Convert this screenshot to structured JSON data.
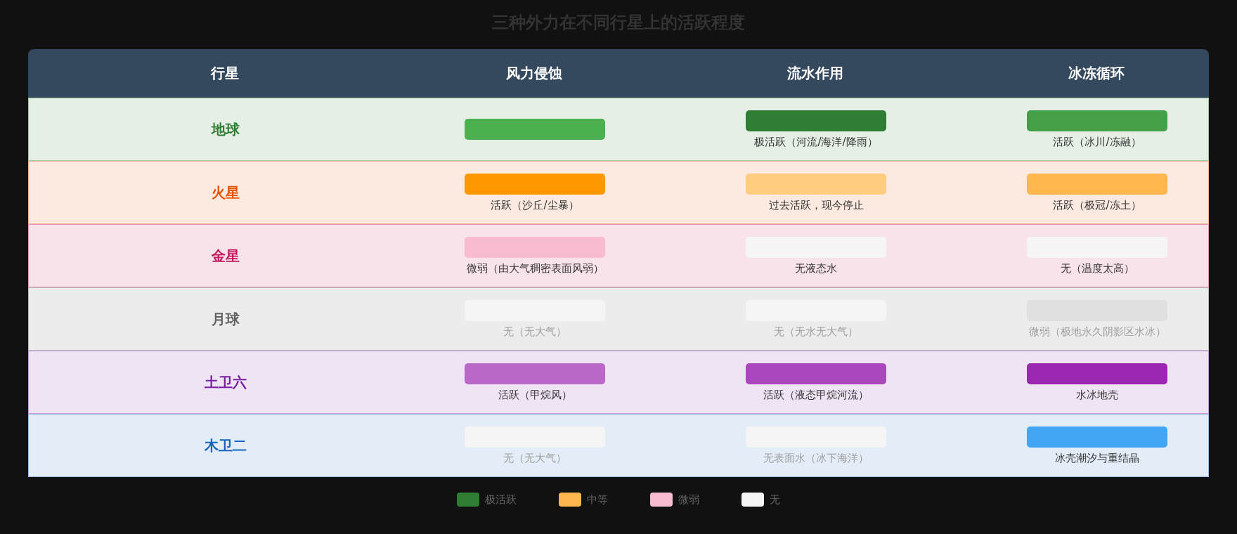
{
  "title": "三种外力在不同行星上的活跃程度",
  "columns": [
    "行星",
    "风力侵蚀",
    "流水作用",
    "冰冻循环"
  ],
  "rows": [
    {
      "planet": "地球",
      "color": "#2e7d32",
      "cells": [
        {
          "color": "#4caf50"
        },
        {
          "text": "极活跃（河流/海洋/降雨）",
          "dimmed": false,
          "color": "#2e7d32"
        },
        {
          "text": "活跃（冰川/冻融）",
          "dimmed": false,
          "color": "#43a047"
        }
      ]
    },
    {
      "planet": "火星",
      "color": "#e65100",
      "cells": [
        {
          "text": "活跃（沙丘/尘暴）",
          "dimmed": false,
          "color": "#ff9800"
        },
        {
          "text": "过去活跃，现今停止",
          "dimmed": false,
          "color": "#ffcc80"
        },
        {
          "text": "活跃（极冠/冻土）",
          "dimmed": false,
          "color": "#ffb74d"
        }
      ]
    },
    {
      "planet": "金星",
      "color": "#c2185b",
      "cells": [
        {
          "text": "微弱（由大气稠密表面风弱）",
          "dimmed": false,
          "color": "#f8bbd0"
        },
        {
          "text": "无液态水",
          "dimmed": false,
          "color": "#f5f5f5"
        },
        {
          "text": "无（温度太高）",
          "dimmed": false,
          "color": "#f5f5f5"
        }
      ]
    },
    {
      "planet": "月球",
      "color": "#616161",
      "cells": [
        {
          "text": "无（无大气）",
          "dimmed": true,
          "color": "#f5f5f5"
        },
        {
          "text": "无（无水无大气）",
          "dimmed": true,
          "color": "#f5f5f5"
        },
        {
          "text": "微弱（极地永久阴影区水冰）",
          "dimmed": true,
          "color": "#e0e0e0"
        }
      ]
    },
    {
      "planet": "土卫六",
      "color": "#7b1fa2",
      "cells": [
        {
          "text": "活跃（甲烷风）",
          "dimmed": false,
          "color": "#ba68c8"
        },
        {
          "text": "活跃（液态甲烷河流）",
          "dimmed": false,
          "color": "#ab47bc"
        },
        {
          "text": "水冰地壳",
          "dimmed": false,
          "color": "#9c27b0"
        }
      ]
    },
    {
      "planet": "木卫二",
      "color": "#1565c0",
      "cells": [
        {
          "text": "无（无大气）",
          "dimmed": true,
          "color": "#f5f5f5"
        },
        {
          "text": "无表面水（冰下海洋）",
          "dimmed": true,
          "color": "#f5f5f5"
        },
        {
          "text": "冰壳潮汐与重结晶",
          "dimmed": false,
          "color": "#42a5f5"
        }
      ]
    }
  ],
  "legend": [
    {
      "label": "极活跃",
      "color": "#2e7d32"
    },
    {
      "label": "中等",
      "color": "#ffb74d"
    },
    {
      "label": "微弱",
      "color": "#f8bbd0"
    },
    {
      "label": "无",
      "color": "#f5f5f5"
    }
  ]
}
